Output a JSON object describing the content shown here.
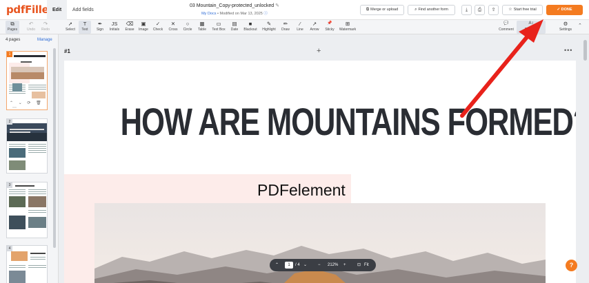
{
  "app": {
    "logo": "pdfFiller"
  },
  "tabs": [
    {
      "label": "Edit"
    },
    {
      "label": "Add fields"
    }
  ],
  "document": {
    "title": "03 Mountain_Copy-protected_unlocked",
    "location": "My Docs",
    "modified": "Modified on Mar 13, 2025"
  },
  "header_buttons": {
    "merge": "Merge or upload",
    "find": "Find another form",
    "trial": "Start free trial",
    "done": "DONE"
  },
  "tools": [
    {
      "label": "Pages",
      "icon": "pages-icon",
      "glyph": "⧉"
    },
    {
      "label": "Undo",
      "icon": "undo-icon",
      "glyph": "↶"
    },
    {
      "label": "Redo",
      "icon": "redo-icon",
      "glyph": "↷"
    },
    {
      "label": "Select",
      "icon": "cursor-icon",
      "glyph": "➚"
    },
    {
      "label": "Text",
      "icon": "text-icon",
      "glyph": "T"
    },
    {
      "label": "Sign",
      "icon": "sign-icon",
      "glyph": "✒"
    },
    {
      "label": "Initials",
      "icon": "initials-icon",
      "glyph": "JS"
    },
    {
      "label": "Erase",
      "icon": "eraser-icon",
      "glyph": "⌫"
    },
    {
      "label": "Image",
      "icon": "image-icon",
      "glyph": "▣"
    },
    {
      "label": "Check",
      "icon": "check-icon",
      "glyph": "✓"
    },
    {
      "label": "Cross",
      "icon": "cross-icon",
      "glyph": "✕"
    },
    {
      "label": "Circle",
      "icon": "circle-icon",
      "glyph": "○"
    },
    {
      "label": "Table",
      "icon": "table-icon",
      "glyph": "▦"
    },
    {
      "label": "Text Box",
      "icon": "textbox-icon",
      "glyph": "▭"
    },
    {
      "label": "Date",
      "icon": "calendar-icon",
      "glyph": "▤"
    },
    {
      "label": "Blackout",
      "icon": "blackout-icon",
      "glyph": "■"
    },
    {
      "label": "Highlight",
      "icon": "highlighter-icon",
      "glyph": "✎"
    },
    {
      "label": "Draw",
      "icon": "pencil-icon",
      "glyph": "✏"
    },
    {
      "label": "Line",
      "icon": "line-icon",
      "glyph": "⁄"
    },
    {
      "label": "Arrow",
      "icon": "arrow-icon",
      "glyph": "↗"
    },
    {
      "label": "Sticky",
      "icon": "sticky-icon",
      "glyph": "📌"
    },
    {
      "label": "Watermark",
      "icon": "watermark-icon",
      "glyph": "⊞"
    },
    {
      "label": "Comment",
      "icon": "comment-icon",
      "glyph": "💬"
    },
    {
      "label": "Replace",
      "icon": "replace-icon",
      "glyph": "A↕"
    },
    {
      "label": "Settings",
      "icon": "gear-icon",
      "glyph": "⚙"
    }
  ],
  "sidebar": {
    "count": "4 pages",
    "manage": "Manage",
    "thumbs": [
      {
        "num": "1"
      },
      {
        "num": "2"
      },
      {
        "num": "3"
      },
      {
        "num": "4"
      }
    ]
  },
  "canvas": {
    "page_label": "#1",
    "headline": "HOW ARE MOUNTAINS FORMED?",
    "watermark_text": "PDFelement"
  },
  "zoom": {
    "page": "1",
    "total": "/ 4",
    "zoom": "212%",
    "fit": "Fit"
  },
  "help": "?",
  "colors": {
    "accent": "#f47b20",
    "link": "#2c6bd6",
    "annotation_arrow": "#e8221b"
  }
}
